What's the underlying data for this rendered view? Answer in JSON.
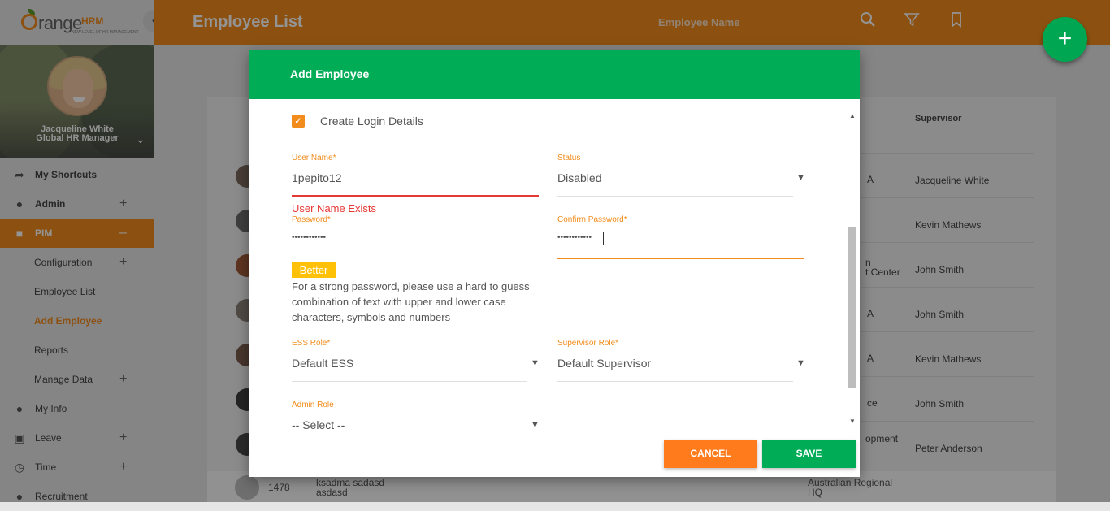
{
  "app": {
    "logo_text": "range",
    "logo_brand": "HRM",
    "logo_tagline": "NEW LEVEL OF HR MANAGEMENT"
  },
  "profile": {
    "name": "Jacqueline White",
    "role": "Global HR Manager"
  },
  "sidebar": {
    "items": [
      {
        "label": "My Shortcuts",
        "icon": "share-arrow-icon",
        "type": "top",
        "plus": false
      },
      {
        "label": "Admin",
        "icon": "admin-users-icon",
        "type": "top",
        "plus": true
      },
      {
        "label": "PIM",
        "icon": "pim-id-icon",
        "type": "top",
        "active": true,
        "minus": true
      },
      {
        "label": "Configuration",
        "type": "sub",
        "plus": true
      },
      {
        "label": "Employee List",
        "type": "sub"
      },
      {
        "label": "Add Employee",
        "type": "sub",
        "current": true
      },
      {
        "label": "Reports",
        "type": "sub"
      },
      {
        "label": "Manage Data",
        "type": "sub",
        "plus": true
      },
      {
        "label": "My Info",
        "icon": "user-circle-icon",
        "type": "top"
      },
      {
        "label": "Leave",
        "icon": "briefcase-icon",
        "type": "top",
        "plus": true
      },
      {
        "label": "Time",
        "icon": "clock-icon",
        "type": "top",
        "plus": true
      },
      {
        "label": "Recruitment",
        "icon": "recruitment-icon",
        "type": "top"
      }
    ]
  },
  "header": {
    "title": "Employee List",
    "search_placeholder": "Employee Name"
  },
  "table": {
    "supervisor_header": "Supervisor",
    "rows": [
      {
        "location": "A",
        "supervisor": "Jacqueline White"
      },
      {
        "location": "",
        "supervisor": "Kevin Mathews"
      },
      {
        "location": "n\nt Center",
        "supervisor": "John Smith"
      },
      {
        "location": "A",
        "supervisor": "John Smith"
      },
      {
        "location": "A",
        "supervisor": "Kevin Mathews"
      },
      {
        "location": "ce",
        "supervisor": "John Smith"
      },
      {
        "location": "opment",
        "supervisor": "Peter Anderson"
      }
    ],
    "last_row": {
      "id": "1478",
      "name_line1": "ksadma sadasd",
      "name_line2": "asdasd",
      "location_line1": "Australian Regional",
      "location_line2": "HQ"
    }
  },
  "modal": {
    "title": "Add Employee",
    "create_login_label": "Create Login Details",
    "create_login_checked": true,
    "username": {
      "label": "User Name",
      "required": "*",
      "value": "1pepito12",
      "error": "User Name Exists"
    },
    "status": {
      "label": "Status",
      "value": "Disabled"
    },
    "password": {
      "label": "Password",
      "required": "*",
      "value": "••••••••••••"
    },
    "confirm_password": {
      "label": "Confirm Password",
      "required": "*",
      "value": "••••••••••••"
    },
    "strength": {
      "badge": "Better",
      "hint": "For a strong password, please use a hard to guess combination of text with upper and lower case characters, symbols and numbers",
      "color": "#ffc107"
    },
    "ess_role": {
      "label": "ESS Role",
      "required": "*",
      "value": "Default ESS"
    },
    "supervisor_role": {
      "label": "Supervisor Role",
      "required": "*",
      "value": "Default Supervisor"
    },
    "admin_role": {
      "label": "Admin Role",
      "value": "-- Select --"
    },
    "cancel_label": "CANCEL",
    "save_label": "SAVE"
  },
  "colors": {
    "brand_orange": "#f28c1c",
    "header_green": "#00ad56",
    "error_red": "#e53935"
  }
}
